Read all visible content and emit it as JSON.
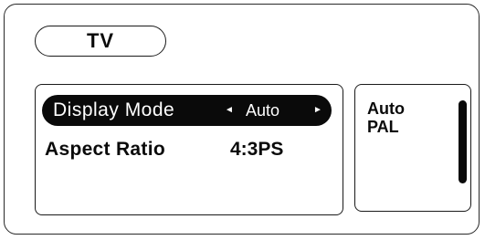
{
  "tab": {
    "label": "TV"
  },
  "settings": {
    "rows": [
      {
        "label": "Display Mode",
        "value": "Auto",
        "left_arrow": "◄",
        "right_arrow": "►"
      },
      {
        "label": "Aspect Ratio",
        "value": "4:3PS"
      }
    ]
  },
  "options": {
    "items": [
      "Auto",
      "PAL"
    ]
  }
}
